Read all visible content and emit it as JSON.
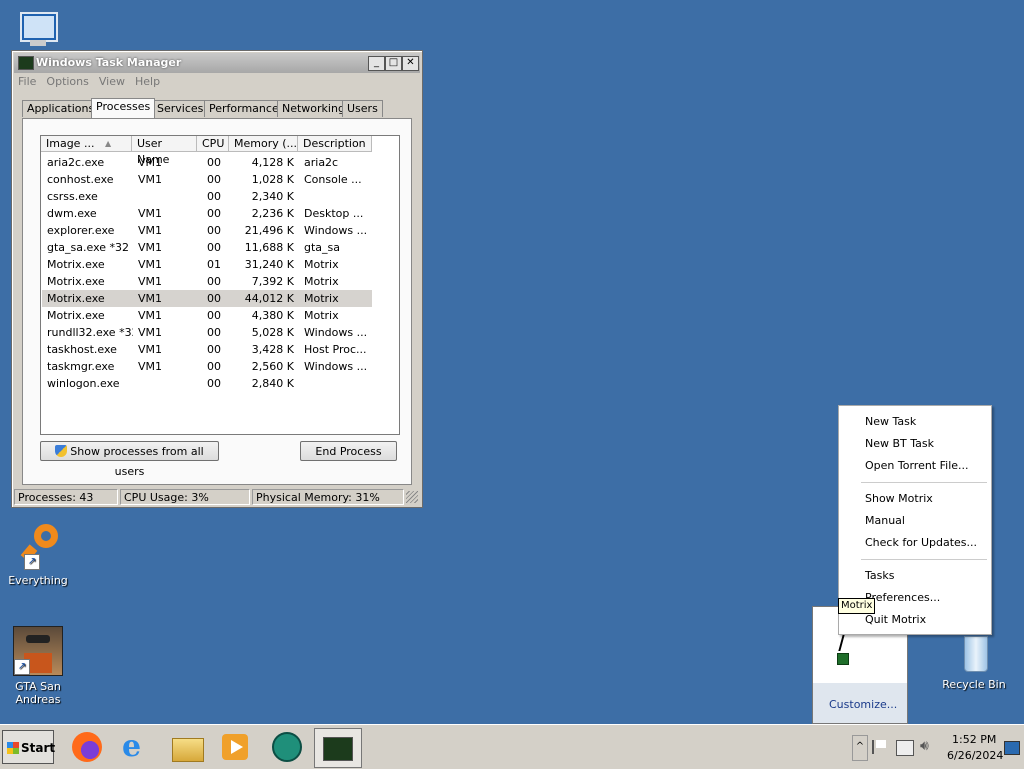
{
  "desktop": {
    "icons": [
      {
        "label": "Everything"
      },
      {
        "label": "GTA San Andreas"
      },
      {
        "label": "Recycle Bin"
      }
    ]
  },
  "taskmgr": {
    "title": "Windows Task Manager",
    "menu": [
      "File",
      "Options",
      "View",
      "Help"
    ],
    "tabs": [
      "Applications",
      "Processes",
      "Services",
      "Performance",
      "Networking",
      "Users"
    ],
    "active_tab": "Processes",
    "columns": [
      "Image ...",
      "User Name",
      "CPU",
      "Memory (...",
      "Description"
    ],
    "rows": [
      {
        "image": "aria2c.exe",
        "user": "VM1",
        "cpu": "00",
        "mem": "4,128 K",
        "desc": "aria2c"
      },
      {
        "image": "conhost.exe",
        "user": "VM1",
        "cpu": "00",
        "mem": "1,028 K",
        "desc": "Console ..."
      },
      {
        "image": "csrss.exe",
        "user": "",
        "cpu": "00",
        "mem": "2,340 K",
        "desc": ""
      },
      {
        "image": "dwm.exe",
        "user": "VM1",
        "cpu": "00",
        "mem": "2,236 K",
        "desc": "Desktop ..."
      },
      {
        "image": "explorer.exe",
        "user": "VM1",
        "cpu": "00",
        "mem": "21,496 K",
        "desc": "Windows ..."
      },
      {
        "image": "gta_sa.exe *32",
        "user": "VM1",
        "cpu": "00",
        "mem": "11,688 K",
        "desc": "gta_sa"
      },
      {
        "image": "Motrix.exe",
        "user": "VM1",
        "cpu": "01",
        "mem": "31,240 K",
        "desc": "Motrix"
      },
      {
        "image": "Motrix.exe",
        "user": "VM1",
        "cpu": "00",
        "mem": "7,392 K",
        "desc": "Motrix"
      },
      {
        "image": "Motrix.exe",
        "user": "VM1",
        "cpu": "00",
        "mem": "44,012 K",
        "desc": "Motrix"
      },
      {
        "image": "Motrix.exe",
        "user": "VM1",
        "cpu": "00",
        "mem": "4,380 K",
        "desc": "Motrix"
      },
      {
        "image": "rundll32.exe *32",
        "user": "VM1",
        "cpu": "00",
        "mem": "5,028 K",
        "desc": "Windows ..."
      },
      {
        "image": "taskhost.exe",
        "user": "VM1",
        "cpu": "00",
        "mem": "3,428 K",
        "desc": "Host Proc..."
      },
      {
        "image": "taskmgr.exe",
        "user": "VM1",
        "cpu": "00",
        "mem": "2,560 K",
        "desc": "Windows ..."
      },
      {
        "image": "winlogon.exe",
        "user": "",
        "cpu": "00",
        "mem": "2,840 K",
        "desc": ""
      }
    ],
    "selected_row": 8,
    "show_all_label": "Show processes from all users",
    "end_process_label": "End Process",
    "status": {
      "processes": "Processes: 43",
      "cpu": "CPU Usage: 3%",
      "memory": "Physical Memory: 31%"
    }
  },
  "context_menu": {
    "items": [
      "New Task",
      "New BT Task",
      "Open Torrent File...",
      "Show Motrix",
      "Manual",
      "Check for Updates...",
      "Tasks",
      "Preferences...",
      "Quit Motrix"
    ]
  },
  "tooltip": "Motrix",
  "tray_popup": {
    "customize": "Customize..."
  },
  "taskbar": {
    "start": "Start",
    "time": "1:52 PM",
    "date": "6/26/2024"
  }
}
